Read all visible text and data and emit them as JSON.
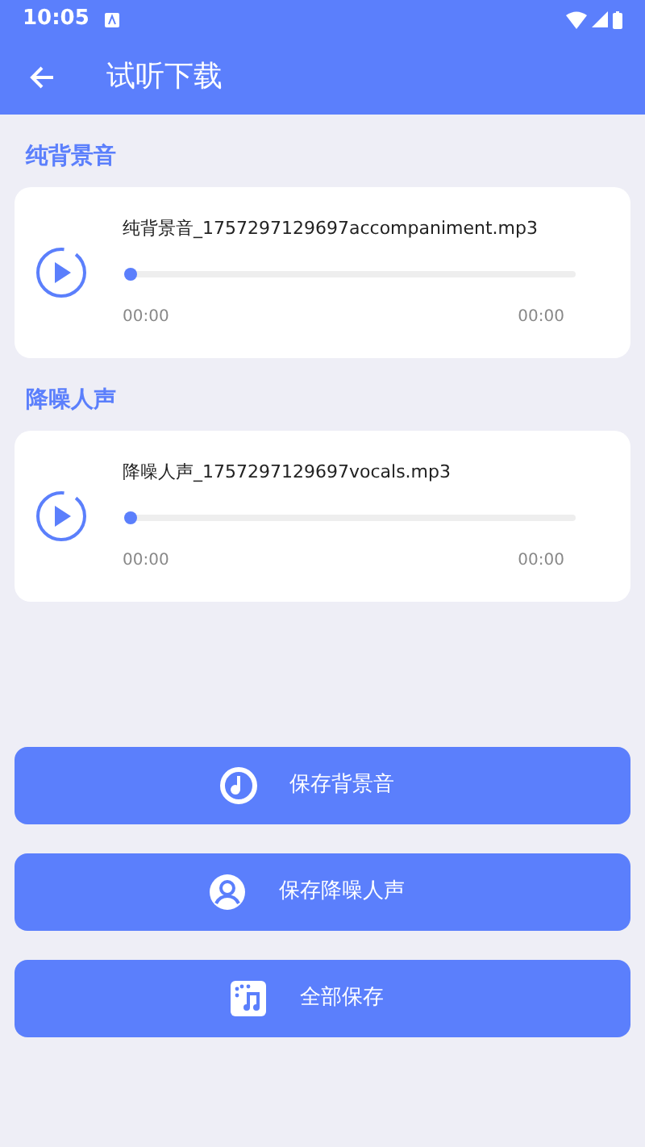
{
  "status_bar": {
    "time": "10:05"
  },
  "app_bar": {
    "title": "试听下载"
  },
  "tracks": [
    {
      "section": "纯背景音",
      "file_name": "纯背景音_1757297129697accompaniment.mp3",
      "level": 0,
      "elapsed": "00:00",
      "duration": "00:00"
    },
    {
      "section": "降噪人声",
      "file_name": "降噪人声_1757297129697vocals.mp3",
      "level": 0,
      "elapsed": "00:00",
      "duration": "00:00"
    }
  ],
  "buttons": [
    {
      "kind": "disc",
      "label": "保存背景音"
    },
    {
      "kind": "person",
      "label": "保存降噪人声"
    },
    {
      "kind": "all",
      "label": "全部保存"
    }
  ]
}
